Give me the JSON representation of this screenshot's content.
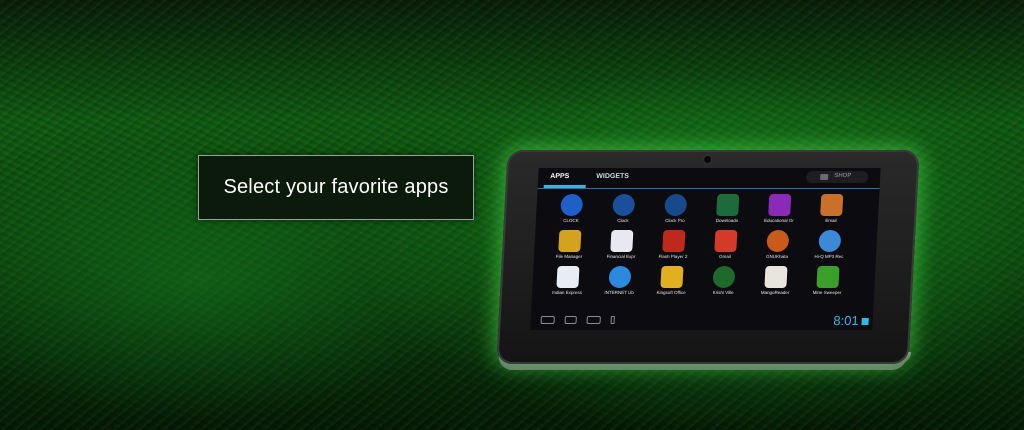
{
  "banner": {
    "text": "Select your favorite apps"
  },
  "tablet": {
    "tabs": {
      "apps": "APPS",
      "widgets": "WIDGETS",
      "shop": "SHOP"
    },
    "apps": [
      {
        "label": "CLOCK",
        "color": "#1e5fc8",
        "icon": "clock-icon"
      },
      {
        "label": "Clock",
        "color": "#1a4f9c",
        "icon": "clock-icon"
      },
      {
        "label": "Clock Pro",
        "color": "#174a8a",
        "icon": "clock-icon"
      },
      {
        "label": "Downloads",
        "color": "#1d6b3c",
        "icon": "download-icon"
      },
      {
        "label": "Educational Gr",
        "color": "#8a2ab8",
        "icon": "education-icon"
      },
      {
        "label": "Email",
        "color": "#c9702a",
        "icon": "email-icon"
      },
      {
        "label": "File Manager",
        "color": "#d4a21c",
        "icon": "folder-icon"
      },
      {
        "label": "Financial Expr",
        "color": "#e8e8f0",
        "icon": "fe-icon"
      },
      {
        "label": "Flash Player 2",
        "color": "#c0281e",
        "icon": "flash-icon"
      },
      {
        "label": "Gmail",
        "color": "#d43a2a",
        "icon": "gmail-icon"
      },
      {
        "label": "GNUKhata",
        "color": "#c85a1a",
        "icon": "gnu-icon"
      },
      {
        "label": "Hi-Q MP3 Rec",
        "color": "#3a8ad8",
        "icon": "microphone-icon"
      },
      {
        "label": "Indian Express",
        "color": "#e8edf5",
        "icon": "news-icon"
      },
      {
        "label": "INTERNET Ub",
        "color": "#2a8ae0",
        "icon": "globe-icon"
      },
      {
        "label": "Kingsoft Office",
        "color": "#e0b020",
        "icon": "office-icon"
      },
      {
        "label": "Krishi Ville",
        "color": "#1e6a2a",
        "icon": "farm-icon"
      },
      {
        "label": "MangoReader",
        "color": "#e8e6dc",
        "icon": "reader-icon"
      },
      {
        "label": "Mine Sweeper",
        "color": "#3aa02a",
        "icon": "mine-icon"
      }
    ],
    "clock": "8:01"
  }
}
